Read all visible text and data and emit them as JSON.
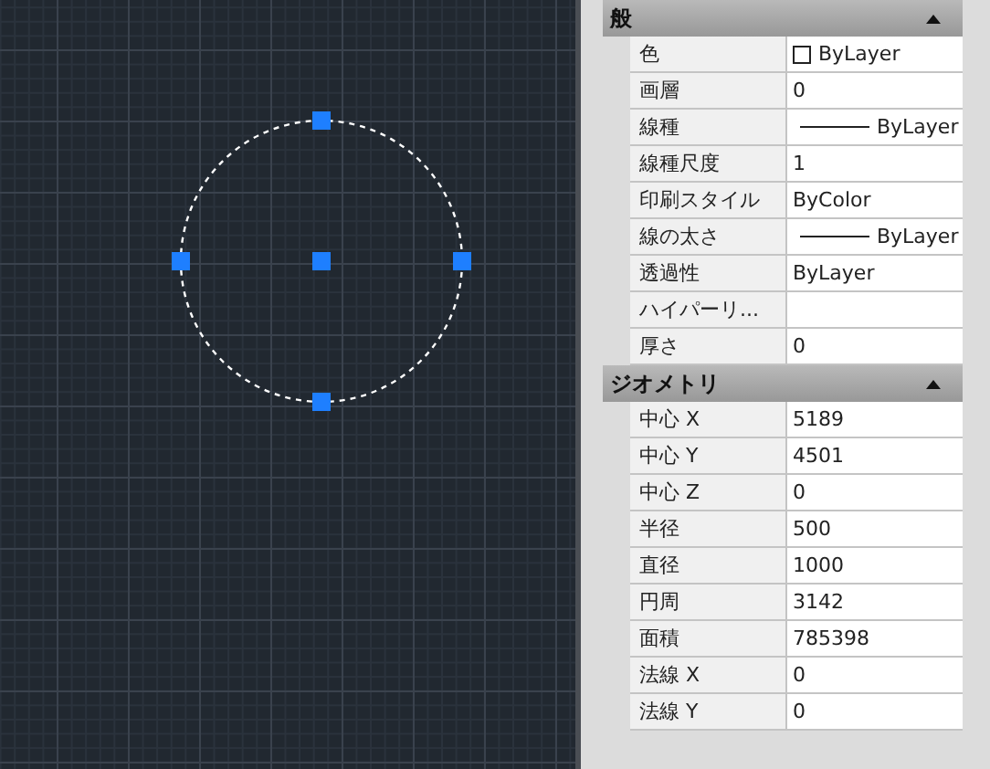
{
  "sections": [
    {
      "title": "般",
      "expanded": true,
      "rows": [
        {
          "label": "色",
          "value": "ByLayer",
          "kind": "color"
        },
        {
          "label": "画層",
          "value": "0",
          "kind": "text"
        },
        {
          "label": "線種",
          "value": "ByLayer",
          "kind": "line"
        },
        {
          "label": "線種尺度",
          "value": "1",
          "kind": "text"
        },
        {
          "label": "印刷スタイル",
          "value": "ByColor",
          "kind": "text"
        },
        {
          "label": "線の太さ",
          "value": "ByLayer",
          "kind": "line"
        },
        {
          "label": "透過性",
          "value": "ByLayer",
          "kind": "text"
        },
        {
          "label": "ハイパーリ...",
          "value": "",
          "kind": "text"
        },
        {
          "label": "厚さ",
          "value": "0",
          "kind": "text"
        }
      ]
    },
    {
      "title": "ジオメトリ",
      "expanded": true,
      "rows": [
        {
          "label": "中心 X",
          "value": "5189",
          "kind": "text"
        },
        {
          "label": "中心 Y",
          "value": "4501",
          "kind": "text"
        },
        {
          "label": "中心 Z",
          "value": "0",
          "kind": "text"
        },
        {
          "label": "半径",
          "value": "500",
          "kind": "text"
        },
        {
          "label": "直径",
          "value": "1000",
          "kind": "text"
        },
        {
          "label": "円周",
          "value": "3142",
          "kind": "text"
        },
        {
          "label": "面積",
          "value": "785398",
          "kind": "text"
        },
        {
          "label": "法線 X",
          "value": "0",
          "kind": "text"
        },
        {
          "label": "法線 Y",
          "value": "0",
          "kind": "text"
        }
      ]
    }
  ]
}
